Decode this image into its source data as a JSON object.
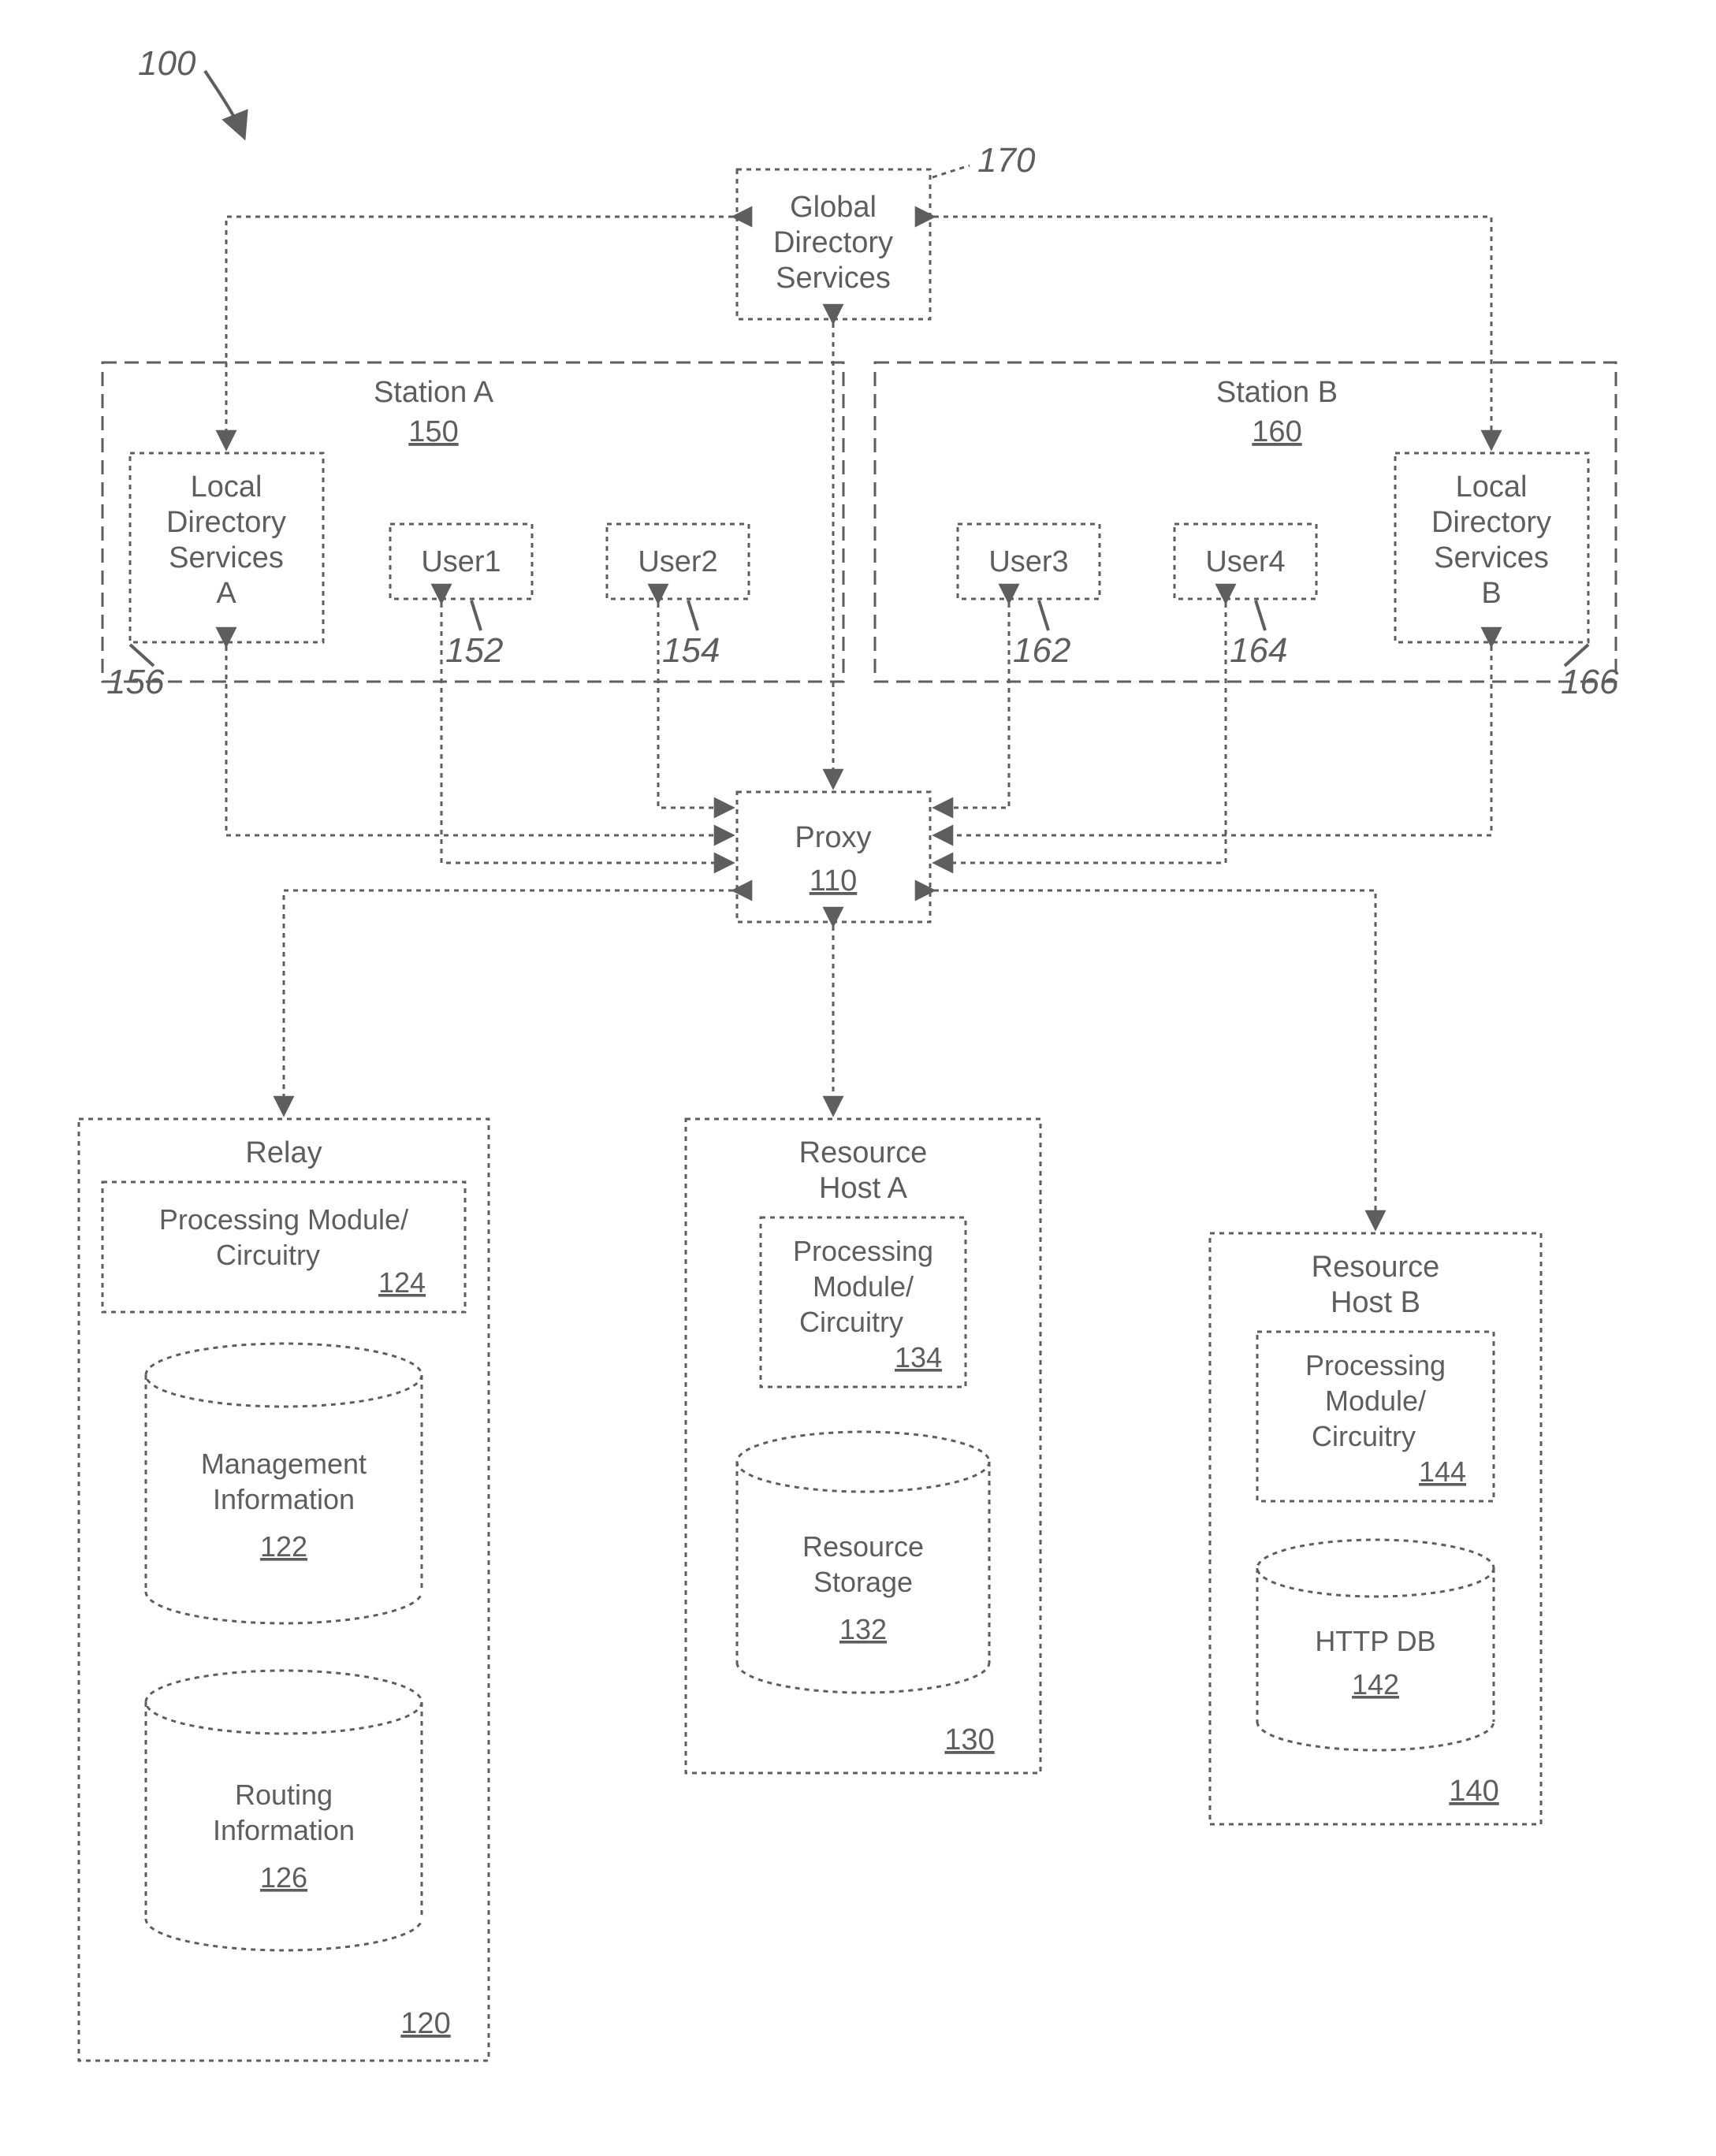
{
  "fig": "100",
  "global": {
    "line1": "Global",
    "line2": "Directory",
    "line3": "Services",
    "ref": "170"
  },
  "stationA": {
    "title": "Station A",
    "ref": "150",
    "ldsa": {
      "line1": "Local",
      "line2": "Directory",
      "line3": "Services",
      "line4": "A",
      "ref": "156"
    },
    "user1": {
      "label": "User1",
      "ref": "152"
    },
    "user2": {
      "label": "User2",
      "ref": "154"
    }
  },
  "stationB": {
    "title": "Station B",
    "ref": "160",
    "ldsb": {
      "line1": "Local",
      "line2": "Directory",
      "line3": "Services",
      "line4": "B",
      "ref": "166"
    },
    "user3": {
      "label": "User3",
      "ref": "162"
    },
    "user4": {
      "label": "User4",
      "ref": "164"
    }
  },
  "proxy": {
    "label": "Proxy",
    "ref": "110"
  },
  "relay": {
    "title": "Relay",
    "ref": "120",
    "proc": {
      "line1": "Processing Module/",
      "line2": "Circuitry",
      "ref": "124"
    },
    "mgmt": {
      "line1": "Management",
      "line2": "Information",
      "ref": "122"
    },
    "route": {
      "line1": "Routing",
      "line2": "Information",
      "ref": "126"
    }
  },
  "hostA": {
    "line1": "Resource",
    "line2": "Host A",
    "ref": "130",
    "proc": {
      "line1": "Processing",
      "line2": "Module/",
      "line3": "Circuitry",
      "ref": "134"
    },
    "store": {
      "line1": "Resource",
      "line2": "Storage",
      "ref": "132"
    }
  },
  "hostB": {
    "line1": "Resource",
    "line2": "Host B",
    "ref": "140",
    "proc": {
      "line1": "Processing",
      "line2": "Module/",
      "line3": "Circuitry",
      "ref": "144"
    },
    "db": {
      "line1": "HTTP DB",
      "ref": "142"
    }
  }
}
